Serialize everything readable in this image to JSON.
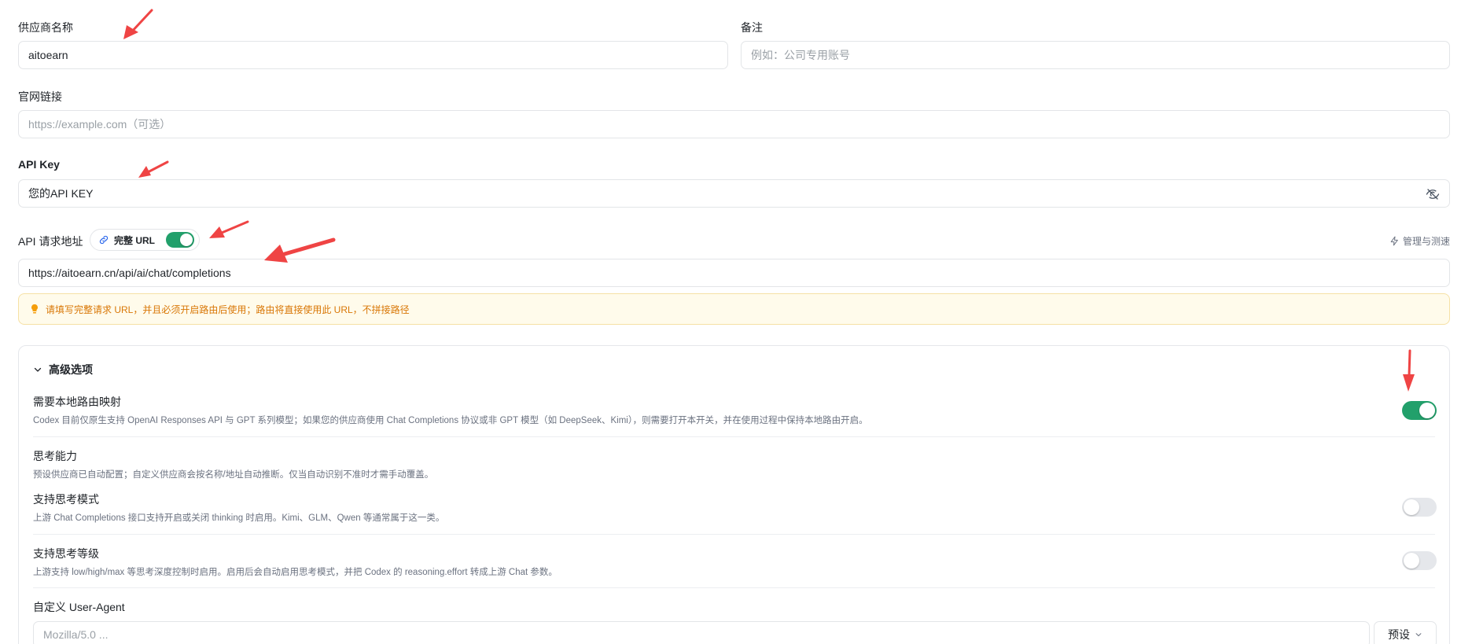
{
  "form": {
    "provider_name": {
      "label": "供应商名称",
      "value": "aitoearn"
    },
    "remark": {
      "label": "备注",
      "placeholder": "例如：公司专用账号"
    },
    "website": {
      "label": "官网链接",
      "placeholder": "https://example.com（可选）"
    },
    "api_key": {
      "label": "API Key",
      "value": "您的API KEY",
      "toggle_icon": "eye-off-icon"
    },
    "api_url": {
      "label": "API 请求地址",
      "full_url_label": "完整 URL",
      "full_url_on": true,
      "manage_label": "管理与测速",
      "value": "https://aitoearn.cn/api/ai/chat/completions"
    },
    "notice": "请填写完整请求 URL，并且必须开启路由后使用；路由将直接使用此 URL，不拼接路径"
  },
  "advanced": {
    "title": "高级选项",
    "local_routing": {
      "title": "需要本地路由映射",
      "desc": "Codex 目前仅原生支持 OpenAI Responses API 与 GPT 系列模型；如果您的供应商使用 Chat Completions 协议或非 GPT 模型（如 DeepSeek、Kimi），则需要打开本开关，并在使用过程中保持本地路由开启。",
      "on": true
    },
    "thinking": {
      "title": "思考能力",
      "desc": "预设供应商已自动配置；自定义供应商会按名称/地址自动推断。仅当自动识别不准时才需手动覆盖。"
    },
    "thinking_mode": {
      "title": "支持思考模式",
      "desc": "上游 Chat Completions 接口支持开启或关闭 thinking 时启用。Kimi、GLM、Qwen 等通常属于这一类。",
      "on": false
    },
    "thinking_level": {
      "title": "支持思考等级",
      "desc": "上游支持 low/high/max 等思考深度控制时启用。启用后会自动启用思考模式，并把 Codex 的 reasoning.effort 转成上游 Chat 参数。",
      "on": false
    },
    "user_agent": {
      "title": "自定义 User-Agent",
      "placeholder": "Mozilla/5.0 ...",
      "preset_label": "预设"
    }
  },
  "colors": {
    "accent_green": "#22a06b",
    "annotation_red": "#ef4444",
    "notice_text": "#d97706",
    "notice_bg": "#fffbeb"
  }
}
